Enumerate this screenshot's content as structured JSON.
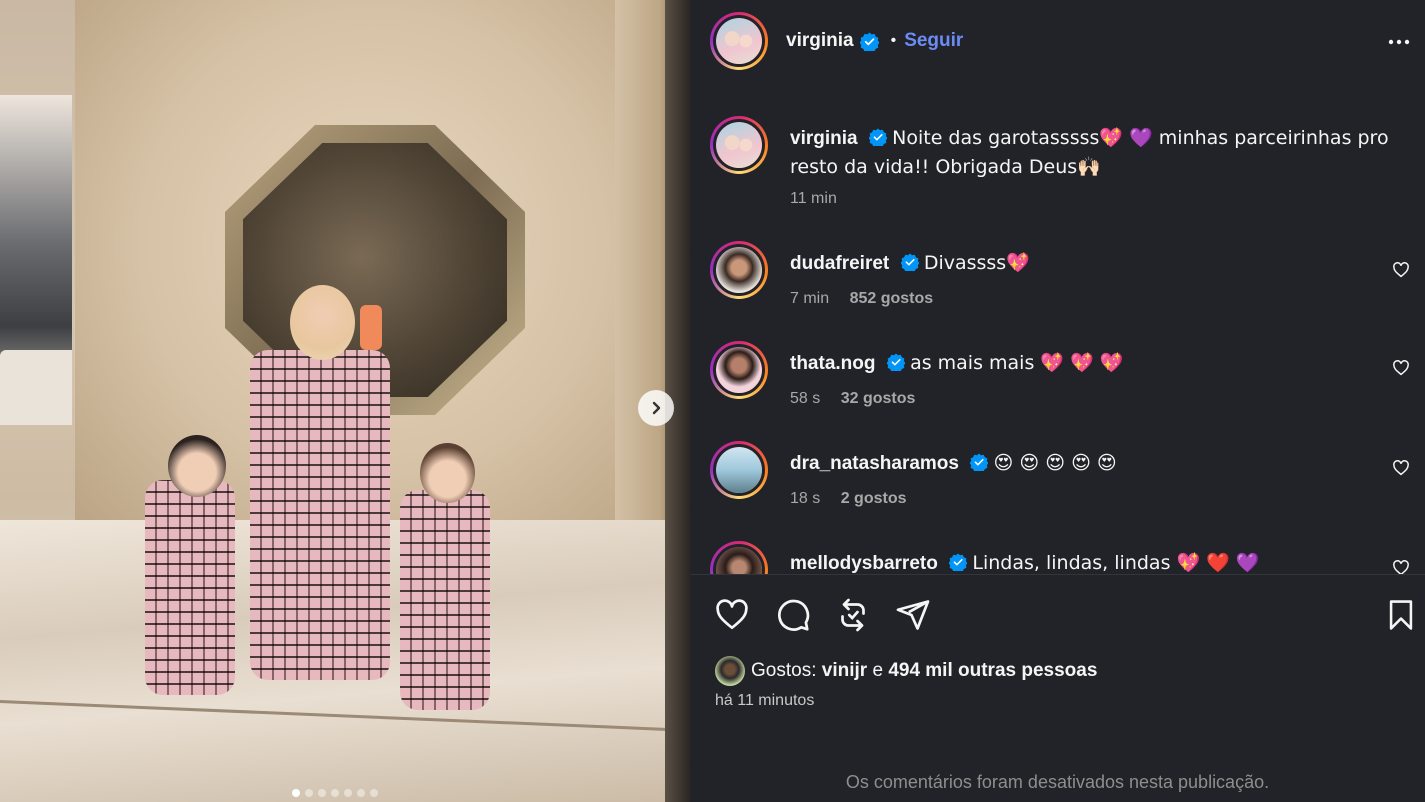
{
  "post": {
    "author": "virginia",
    "follow_label": "Seguir",
    "carousel_slide_count": 7,
    "carousel_active_index": 0
  },
  "comments": [
    {
      "user": "virginia",
      "text": "Noite das garotasssss💖 💜  minhas parceirinhas pro resto da vida!! Obrigada Deus🙌🏻",
      "time": "11 min",
      "likes": ""
    },
    {
      "user": "dudafreiret",
      "text": "Divassss💖",
      "time": "7 min",
      "likes": "852 gostos"
    },
    {
      "user": "thata.nog",
      "text": "as mais mais  💖  💖  💖",
      "time": "58 s",
      "likes": "32 gostos"
    },
    {
      "user": "dra_natasharamos",
      "text": "😍  😍  😍  😍  😍",
      "time": "18 s",
      "likes": "2 gostos"
    },
    {
      "user": "mellodysbarreto",
      "text": "Lindas, lindas, lindas  💖  ❤️  💜",
      "time": "",
      "likes": ""
    }
  ],
  "likes_summary": {
    "prefix": "Gostos:",
    "user": "vinijr",
    "connector": "e",
    "others": "494 mil outras pessoas"
  },
  "posted_ago": "há 11 minutos",
  "comments_disabled": "Os comentários foram desativados nesta publicação.",
  "colors": {
    "panel_bg": "#212328",
    "follow": "#6c8cf5",
    "verified": "#0095f6",
    "muted": "#a8a8a8"
  },
  "icons": [
    "verified-badge-icon",
    "more-options-icon",
    "chevron-right-icon",
    "heart-icon",
    "comment-icon",
    "share-icon",
    "send-icon",
    "bookmark-icon"
  ]
}
